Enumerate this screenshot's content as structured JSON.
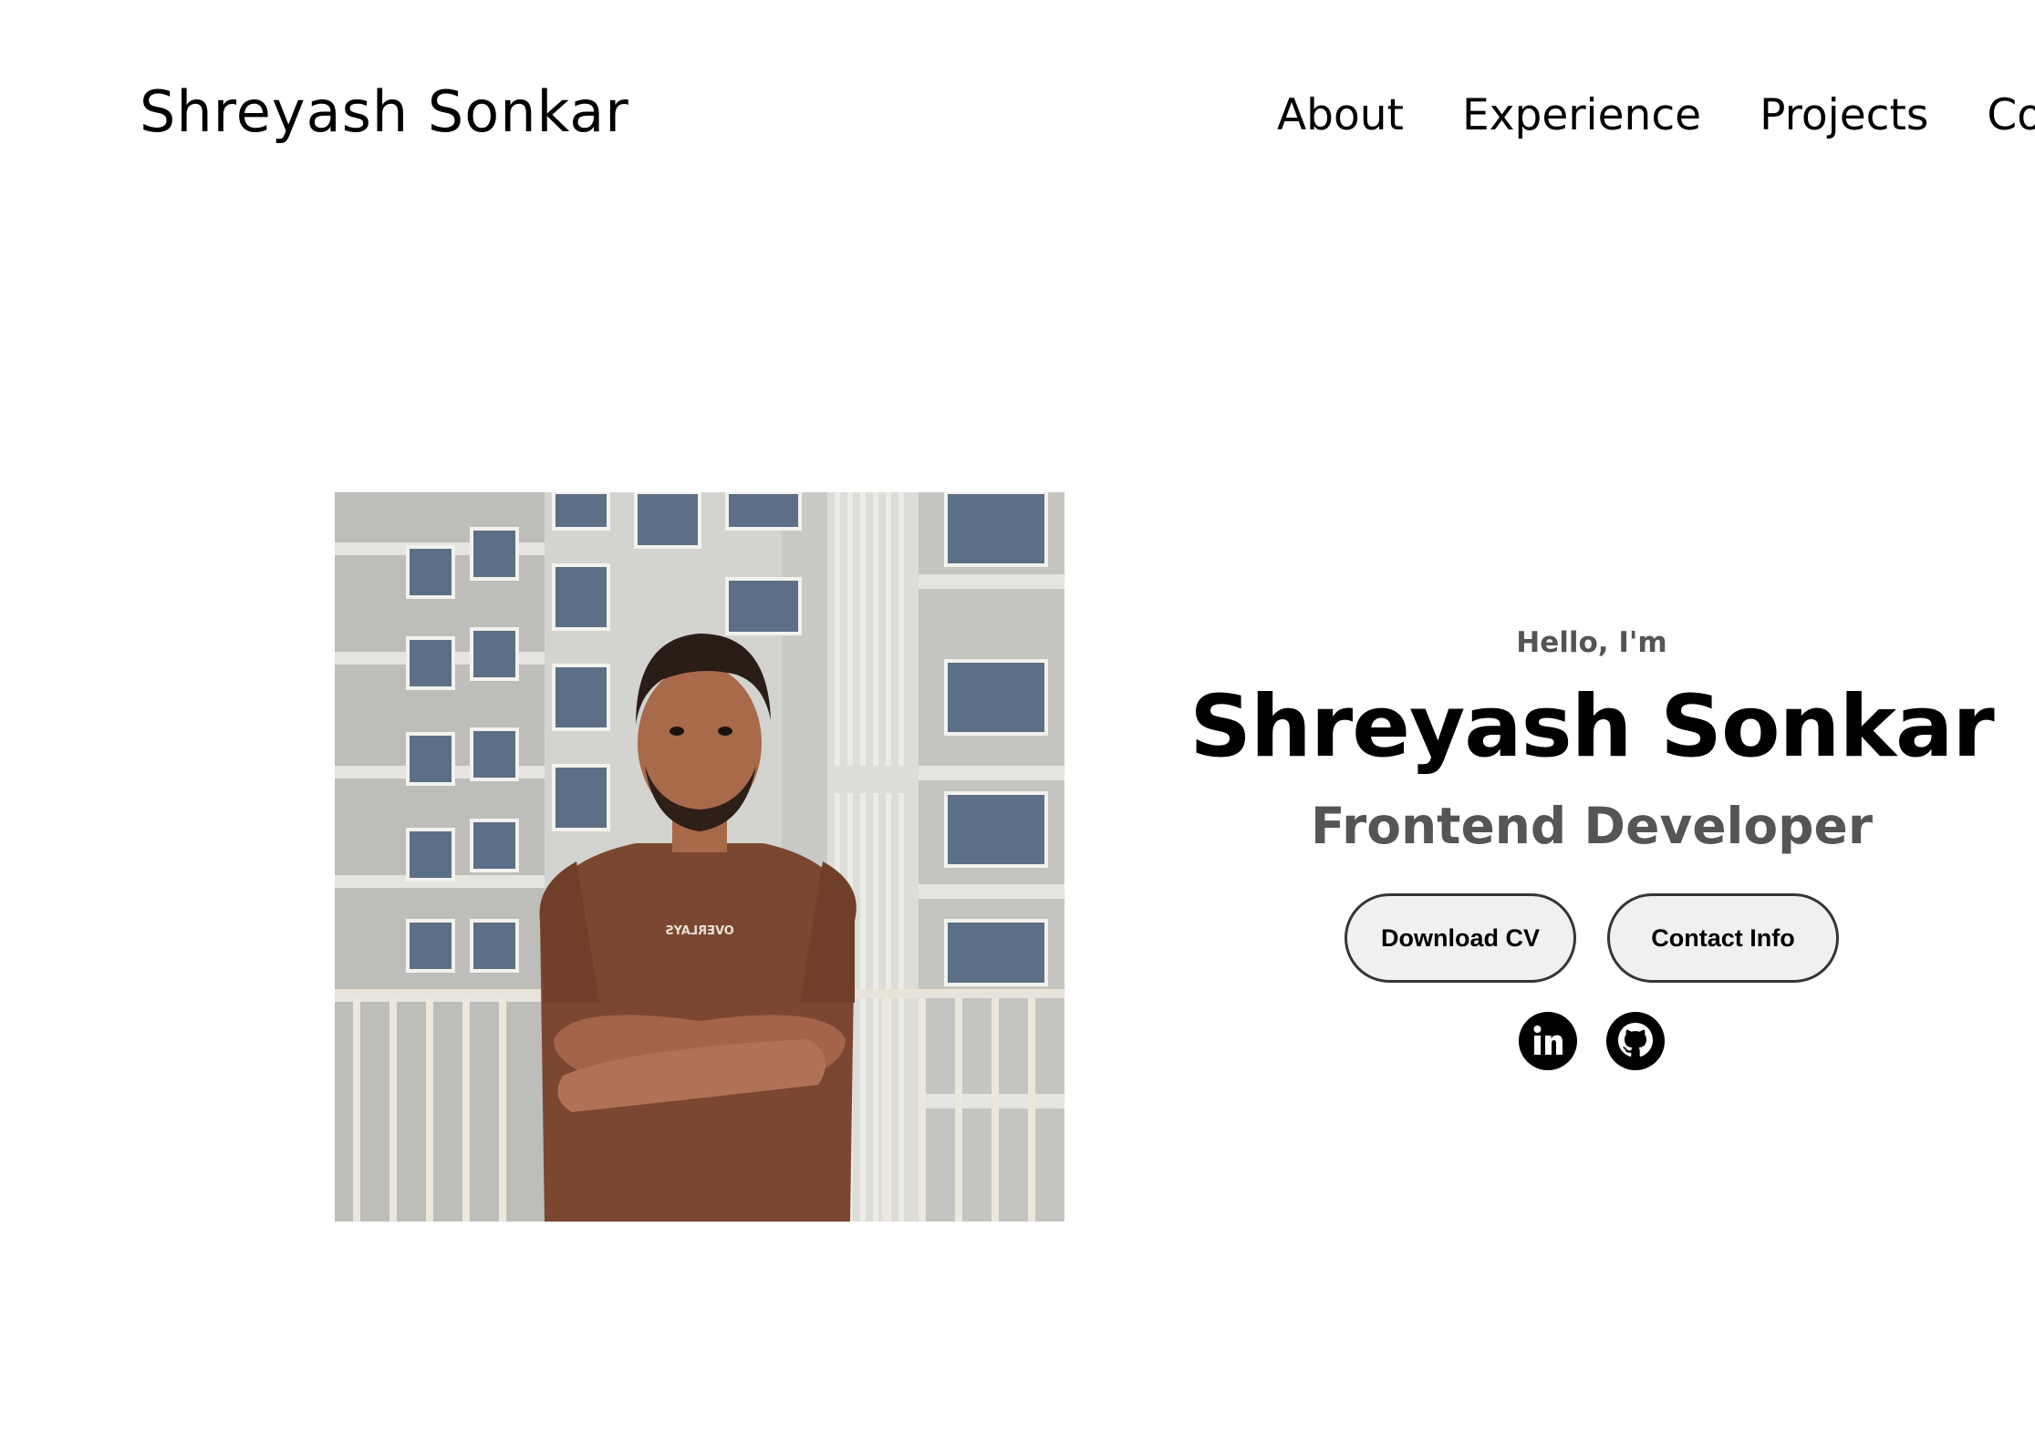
{
  "header": {
    "logo": "Shreyash Sonkar",
    "nav": [
      {
        "label": "About"
      },
      {
        "label": "Experience"
      },
      {
        "label": "Projects"
      },
      {
        "label": "Contact"
      }
    ]
  },
  "profile": {
    "photo_icon": "profile-photo",
    "shirt_text": "OVERLAYS"
  },
  "hero": {
    "greeting": "Hello, I'm",
    "name": "Shreyash Sonkar",
    "role": "Frontend Developer",
    "buttons": [
      {
        "label": "Download CV"
      },
      {
        "label": "Contact Info"
      }
    ],
    "socials": [
      {
        "icon": "linkedin-icon"
      },
      {
        "icon": "github-icon"
      }
    ]
  },
  "colors": {
    "text": "#000000",
    "muted": "#555555",
    "button_bg": "#f0f0f0",
    "button_border": "#353535",
    "background": "#ffffff"
  }
}
